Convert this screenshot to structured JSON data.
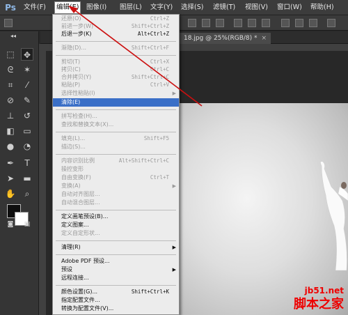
{
  "menubar": {
    "logo": "Ps",
    "items": [
      "文件(F)",
      "编辑(E)",
      "图像(I)",
      "图层(L)",
      "文字(Y)",
      "选择(S)",
      "滤镜(T)",
      "视图(V)",
      "窗口(W)",
      "帮助(H)"
    ],
    "active_index": 1
  },
  "document_tab": {
    "title": "18.jpg @ 25%(RGB/8) *",
    "close": "×"
  },
  "edit_menu": {
    "items": [
      {
        "label": "还原(O)",
        "shortcut": "Ctrl+Z",
        "enabled": false
      },
      {
        "label": "前进一步(W)",
        "shortcut": "Shift+Ctrl+Z",
        "enabled": false
      },
      {
        "label": "后退一步(K)",
        "shortcut": "Alt+Ctrl+Z",
        "enabled": true
      },
      {
        "label": "渐隐(D)...",
        "shortcut": "Shift+Ctrl+F",
        "enabled": false
      },
      {
        "label": "剪切(T)",
        "shortcut": "Ctrl+X",
        "enabled": false
      },
      {
        "label": "拷贝(C)",
        "shortcut": "Ctrl+C",
        "enabled": false
      },
      {
        "label": "合并拷贝(Y)",
        "shortcut": "Shift+Ctrl+C",
        "enabled": false
      },
      {
        "label": "粘贴(P)",
        "shortcut": "Ctrl+V",
        "enabled": false
      },
      {
        "label": "选择性粘贴(I)",
        "shortcut": "",
        "enabled": false,
        "submenu": true
      },
      {
        "label": "清除(E)",
        "shortcut": "",
        "enabled": true,
        "highlighted": true
      },
      {
        "label": "拼写检查(H)...",
        "shortcut": "",
        "enabled": false
      },
      {
        "label": "查找和替换文本(X)...",
        "shortcut": "",
        "enabled": false
      },
      {
        "label": "填充(L)...",
        "shortcut": "Shift+F5",
        "enabled": false
      },
      {
        "label": "描边(S)...",
        "shortcut": "",
        "enabled": false
      },
      {
        "label": "内容识别比例",
        "shortcut": "Alt+Shift+Ctrl+C",
        "enabled": false
      },
      {
        "label": "操控变形",
        "shortcut": "",
        "enabled": false
      },
      {
        "label": "自由变换(F)",
        "shortcut": "Ctrl+T",
        "enabled": false
      },
      {
        "label": "变换(A)",
        "shortcut": "",
        "enabled": false,
        "submenu": true
      },
      {
        "label": "自动对齐图层...",
        "shortcut": "",
        "enabled": false
      },
      {
        "label": "自动混合图层...",
        "shortcut": "",
        "enabled": false
      },
      {
        "label": "定义画笔预设(B)...",
        "shortcut": "",
        "enabled": true
      },
      {
        "label": "定义图案...",
        "shortcut": "",
        "enabled": true
      },
      {
        "label": "定义自定形状...",
        "shortcut": "",
        "enabled": false
      },
      {
        "label": "清理(R)",
        "shortcut": "",
        "enabled": true,
        "submenu": true
      },
      {
        "label": "Adobe PDF 预设...",
        "shortcut": "",
        "enabled": true
      },
      {
        "label": "预设",
        "shortcut": "",
        "enabled": true,
        "submenu": true
      },
      {
        "label": "远程连接...",
        "shortcut": "",
        "enabled": true
      },
      {
        "label": "颜色设置(G)...",
        "shortcut": "Shift+Ctrl+K",
        "enabled": true
      },
      {
        "label": "指定配置文件...",
        "shortcut": "",
        "enabled": true
      },
      {
        "label": "转换为配置文件(V)...",
        "shortcut": "",
        "enabled": true
      }
    ]
  },
  "tools": [
    "move-tool",
    "marquee-tool",
    "lasso-tool",
    "magic-wand-tool",
    "crop-tool",
    "eyedropper-tool",
    "healing-brush-tool",
    "brush-tool",
    "clone-stamp-tool",
    "history-brush-tool",
    "eraser-tool",
    "gradient-tool",
    "blur-tool",
    "dodge-tool",
    "pen-tool",
    "type-tool",
    "path-selection-tool",
    "shape-tool",
    "hand-tool",
    "zoom-tool"
  ],
  "colors": {
    "foreground": "#0e0e0e",
    "background": "#ffffff",
    "highlight": "#3a6fc7",
    "arrow": "#cc1010"
  },
  "watermark": {
    "url": "jb51.net",
    "name": "脚本之家"
  }
}
